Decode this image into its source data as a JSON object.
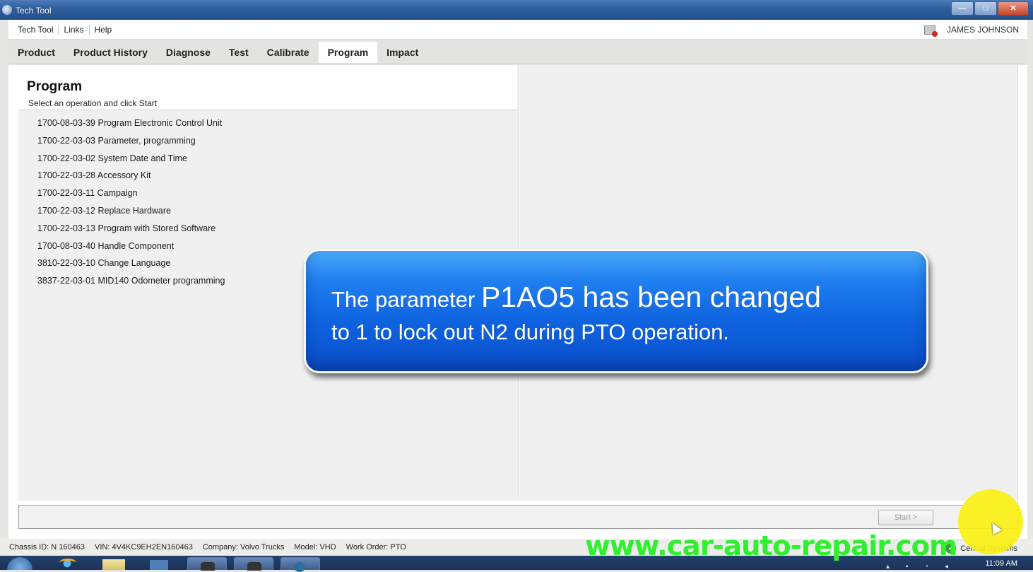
{
  "window": {
    "title": "Tech Tool",
    "controls": {
      "minimize": "—",
      "maximize": "□",
      "close": "✕"
    }
  },
  "menubar": {
    "items": [
      "Tech Tool",
      "Links",
      "Help"
    ],
    "user": "JAMES JOHNSON"
  },
  "tabs": {
    "items": [
      {
        "label": "Product",
        "active": false
      },
      {
        "label": "Product History",
        "active": false
      },
      {
        "label": "Diagnose",
        "active": false
      },
      {
        "label": "Test",
        "active": false
      },
      {
        "label": "Calibrate",
        "active": false
      },
      {
        "label": "Program",
        "active": true
      },
      {
        "label": "Impact",
        "active": false
      }
    ]
  },
  "program": {
    "title": "Program",
    "subtitle": "Select an operation and click Start",
    "operations": [
      "1700-08-03-39 Program Electronic Control Unit",
      "1700-22-03-03 Parameter, programming",
      "1700-22-03-02 System Date and Time",
      "1700-22-03-28 Accessory Kit",
      "1700-22-03-11 Campaign",
      "1700-22-03-12 Replace Hardware",
      "1700-22-03-13 Program with Stored Software",
      "1700-08-03-40 Handle Component",
      "3810-22-03-10 Change Language",
      "3837-22-03-01 MID140 Odometer programming"
    ],
    "start_label": "Start >"
  },
  "callout": {
    "text_before": "The parameter ",
    "text_big": "P1AO5 has been changed",
    "text_after": "to 1 to lock out N2 during PTO operation."
  },
  "statusbar": {
    "chassis_id": "Chassis ID: N 160463",
    "vin": "VIN: 4V4KC9EH2EN160463",
    "company": "Company: Volvo Trucks",
    "model": "Model: VHD",
    "work_order": "Work Order: PTO",
    "central_systems": "Central Systems"
  },
  "taskbar": {
    "clock": "11:09 AM"
  },
  "watermark": "www.car-auto-repair.com",
  "colors": {
    "callout_blue": "#0e62df",
    "watermark_green": "#2ef02e",
    "cursor_highlight": "#faf014"
  }
}
